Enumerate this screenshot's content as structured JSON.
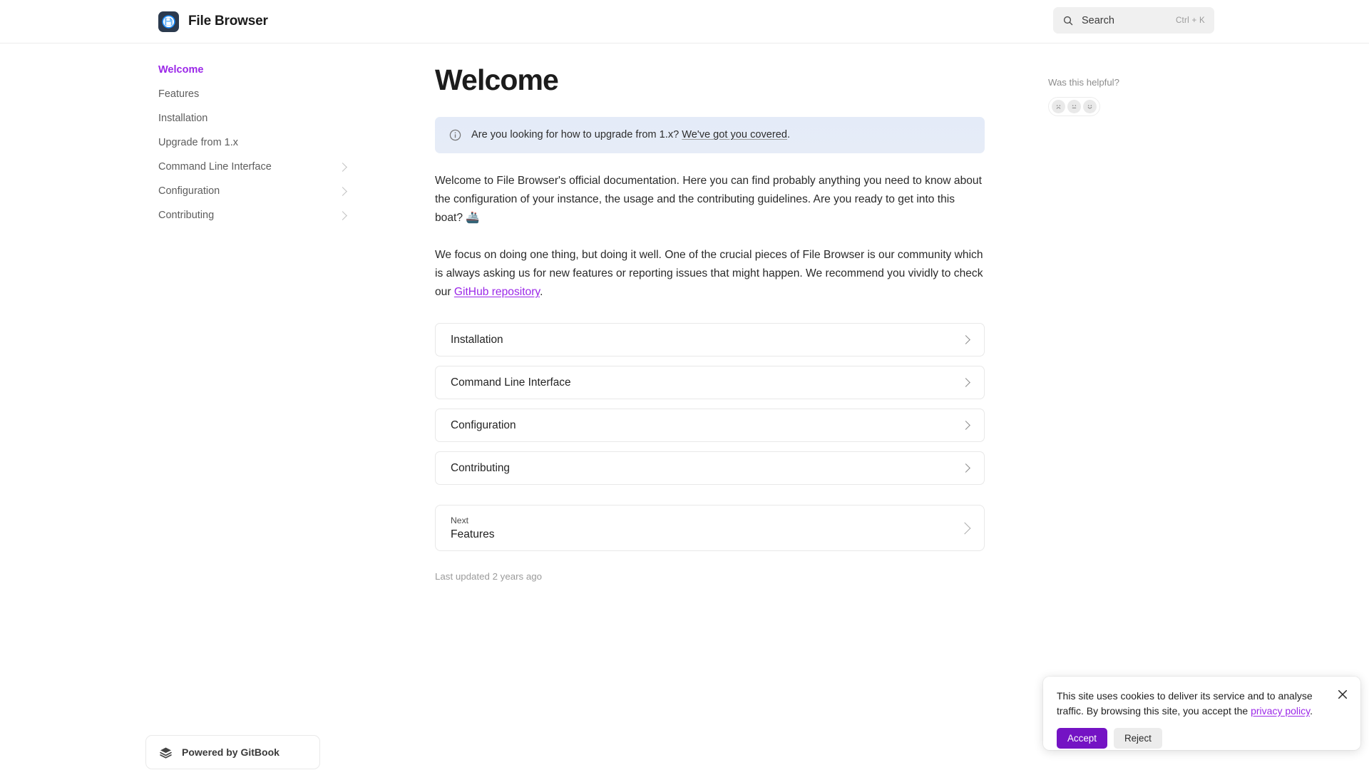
{
  "header": {
    "brand_title": "File Browser",
    "logo_icon": "floppy-disk-icon",
    "search": {
      "icon": "search-icon",
      "placeholder": "Search",
      "shortcut": "Ctrl + K"
    }
  },
  "sidebar": {
    "items": [
      {
        "label": "Welcome",
        "active": true,
        "expandable": false
      },
      {
        "label": "Features",
        "active": false,
        "expandable": false
      },
      {
        "label": "Installation",
        "active": false,
        "expandable": false
      },
      {
        "label": "Upgrade from 1.x",
        "active": false,
        "expandable": false
      },
      {
        "label": "Command Line Interface",
        "active": false,
        "expandable": true
      },
      {
        "label": "Configuration",
        "active": false,
        "expandable": true
      },
      {
        "label": "Contributing",
        "active": false,
        "expandable": true
      }
    ],
    "footer": {
      "label": "Powered by GitBook",
      "icon": "gitbook-books-icon"
    }
  },
  "main": {
    "title": "Welcome",
    "callout": {
      "icon": "info-circle-icon",
      "text_before": "Are you looking for how to upgrade from 1.x? ",
      "link_text": "We've got you covered",
      "text_after": "."
    },
    "paragraph_1": "Welcome to File Browser's official documentation. Here you can find probably anything you need to know about the configuration of your instance, the usage and the contributing guidelines. Are you ready to get into this boat? 🚢",
    "paragraph_2": {
      "text_before": "We focus on doing one thing, but doing it well. One of the crucial pieces of File Browser is our community which is always asking us for new features or reporting issues that might happen. We recommend you vividly to check our ",
      "link_text": "GitHub repository",
      "text_after": "."
    },
    "cards": [
      {
        "label": "Installation"
      },
      {
        "label": "Command Line Interface"
      },
      {
        "label": "Configuration"
      },
      {
        "label": "Contributing"
      }
    ],
    "next": {
      "kicker": "Next",
      "title": "Features"
    },
    "last_updated": "Last updated 2 years ago"
  },
  "rail": {
    "heading": "Was this helpful?",
    "ratings": [
      {
        "name": "sad-face-icon"
      },
      {
        "name": "neutral-face-icon"
      },
      {
        "name": "happy-face-icon"
      }
    ]
  },
  "cookie_banner": {
    "text_before": "This site uses cookies to deliver its service and to analyse traffic. By browsing this site, you accept the ",
    "link_text": "privacy policy",
    "text_after": ".",
    "accept_label": "Accept",
    "reject_label": "Reject",
    "close_icon": "close-icon"
  },
  "colors": {
    "accent_purple": "#9b27e8",
    "button_purple": "#7413c4",
    "callout_blue": "#e4ebf8",
    "logo_navy": "#2b3a4e",
    "logo_blue": "#1a8cff"
  }
}
